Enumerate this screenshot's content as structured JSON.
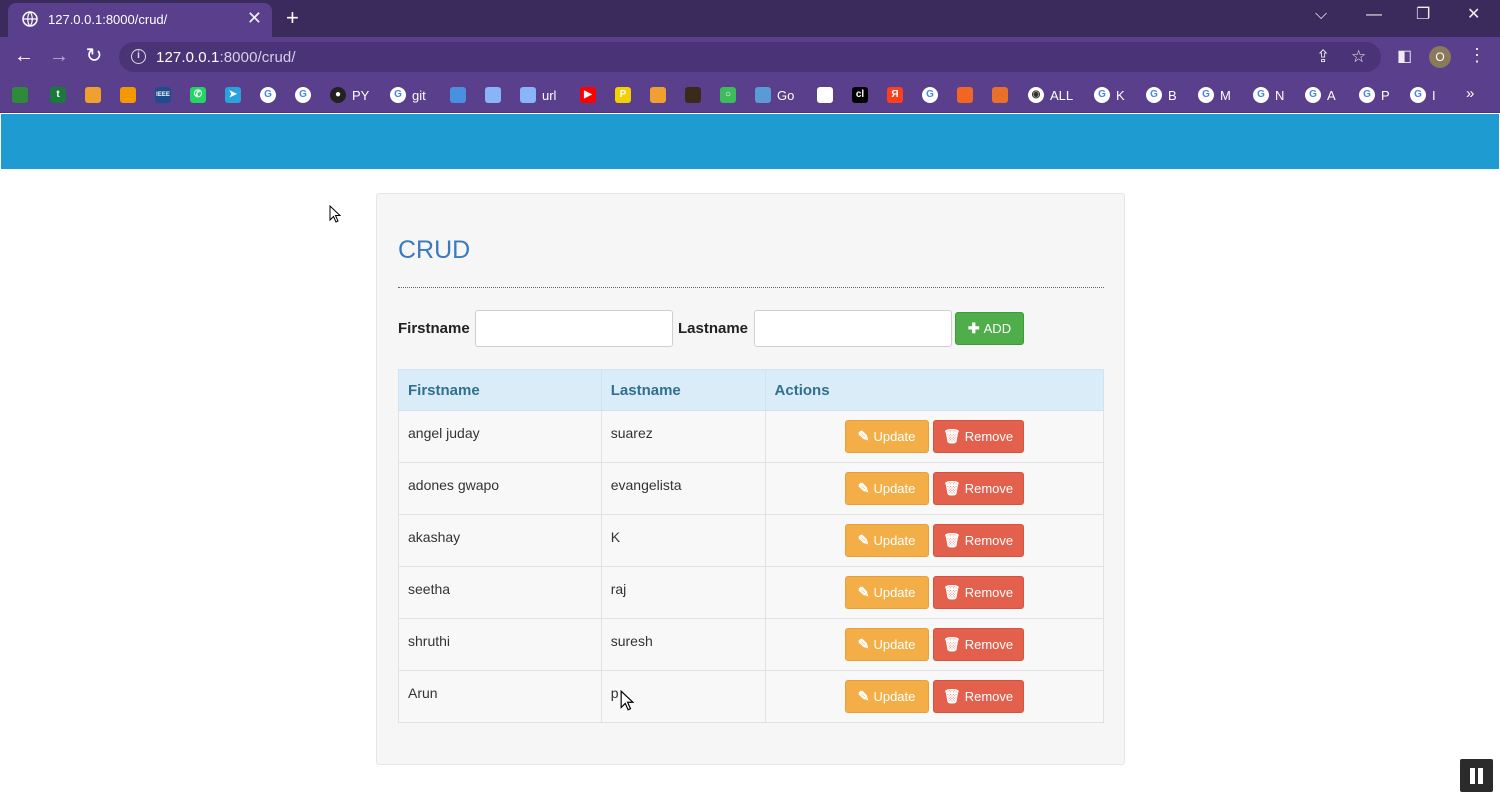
{
  "browser": {
    "tab_title": "127.0.0.1:8000/crud/",
    "tab_close": "✕",
    "new_tab": "+",
    "url_host": "127.0.0.1",
    "url_path": ":8000/crud/",
    "window_controls": {
      "tab_search": "⌵",
      "minimize": "—",
      "restore": "❐",
      "close": "✕"
    },
    "profile_initial": "O",
    "bookmarks": [
      {
        "label": "",
        "icon": "drive-icon",
        "color": "#2e8b3a"
      },
      {
        "label": "",
        "icon": "plus-icon",
        "color": "#1b7a3b"
      },
      {
        "label": "",
        "icon": "folder-icon",
        "color": "#f0a030"
      },
      {
        "label": "",
        "icon": "analytics-icon",
        "color": "#f29900"
      },
      {
        "label": "",
        "icon": "ieee-icon",
        "color": "#1f4d8c"
      },
      {
        "label": "",
        "icon": "whatsapp-icon",
        "color": "#25d366"
      },
      {
        "label": "",
        "icon": "telegram-icon",
        "color": "#2aa3dd"
      },
      {
        "label": "",
        "icon": "google-icon",
        "color": "#ffffff"
      },
      {
        "label": "",
        "icon": "google-icon",
        "color": "#ffffff"
      },
      {
        "label": "PY",
        "icon": "github-icon",
        "color": "#222222"
      },
      {
        "label": "git",
        "icon": "google-icon",
        "color": "#ffffff"
      },
      {
        "label": "",
        "icon": "doc-icon",
        "color": "#4a90e2"
      },
      {
        "label": "",
        "icon": "store-icon",
        "color": "#8ab4f8"
      },
      {
        "label": "url",
        "icon": "wifi-icon",
        "color": "#8ab4f8"
      },
      {
        "label": "",
        "icon": "youtube-icon",
        "color": "#ff0000"
      },
      {
        "label": "",
        "icon": "p-icon",
        "color": "#f5d000"
      },
      {
        "label": "",
        "icon": "camera-icon",
        "color": "#f0a030"
      },
      {
        "label": "",
        "icon": "lion-icon",
        "color": "#3a2a1a"
      },
      {
        "label": "",
        "icon": "ring-icon",
        "color": "#3cbc5a"
      },
      {
        "label": "Go",
        "icon": "swirl-icon",
        "color": "#5b9bd5"
      },
      {
        "label": "",
        "icon": "notion-icon",
        "color": "#ffffff"
      },
      {
        "label": "",
        "icon": "cl-icon",
        "color": "#000000"
      },
      {
        "label": "",
        "icon": "yandex-icon",
        "color": "#fc3f1d"
      },
      {
        "label": "",
        "icon": "google-icon",
        "color": "#ffffff"
      },
      {
        "label": "",
        "icon": "flame-icon",
        "color": "#f26522"
      },
      {
        "label": "",
        "icon": "eye-icon",
        "color": "#e8702a"
      },
      {
        "label": "ALL",
        "icon": "globe-icon",
        "color": "#ffffff"
      },
      {
        "label": "K",
        "icon": "google-icon",
        "color": "#ffffff"
      },
      {
        "label": "B",
        "icon": "google-icon",
        "color": "#ffffff"
      },
      {
        "label": "M",
        "icon": "google-icon",
        "color": "#ffffff"
      },
      {
        "label": "N",
        "icon": "google-icon",
        "color": "#ffffff"
      },
      {
        "label": "A",
        "icon": "google-icon",
        "color": "#ffffff"
      },
      {
        "label": "P",
        "icon": "google-icon",
        "color": "#ffffff"
      },
      {
        "label": "I",
        "icon": "google-icon",
        "color": "#ffffff"
      }
    ],
    "bookmarks_more": "»"
  },
  "app": {
    "title": "CRUD",
    "form": {
      "firstname_label": "Firstname",
      "firstname_value": "",
      "lastname_label": "Lastname",
      "lastname_value": "",
      "add_label": "ADD"
    },
    "table": {
      "headers": [
        "Firstname",
        "Lastname",
        "Actions"
      ],
      "update_label": "Update",
      "remove_label": "Remove",
      "rows": [
        {
          "firstname": "angel juday",
          "lastname": "suarez"
        },
        {
          "firstname": "adones gwapo",
          "lastname": "evangelista"
        },
        {
          "firstname": "akashay",
          "lastname": "K"
        },
        {
          "firstname": "seetha",
          "lastname": "raj"
        },
        {
          "firstname": "shruthi",
          "lastname": "suresh"
        },
        {
          "firstname": "Arun",
          "lastname": "p"
        }
      ]
    }
  },
  "colors": {
    "chrome": "#5a3f8c",
    "header_bar": "#1e9bd0",
    "title": "#3a7bbf",
    "add": "#4fae4a",
    "update": "#f3ae47",
    "remove": "#e3604c"
  }
}
